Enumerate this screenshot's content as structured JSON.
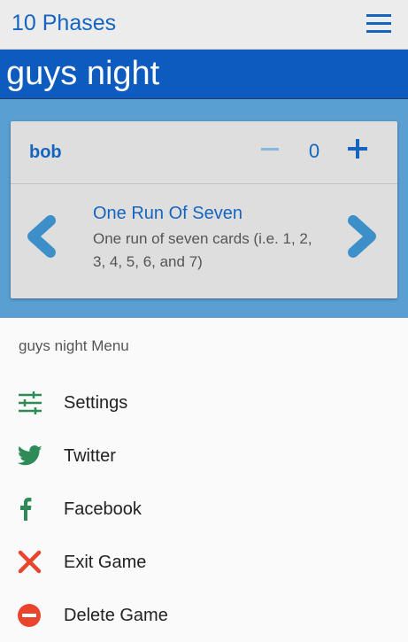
{
  "app": {
    "title": "10 Phases"
  },
  "game": {
    "title": "guys night"
  },
  "player": {
    "name": "bob",
    "score": "0",
    "phase_name": "One Run Of Seven",
    "phase_description": "One run of seven cards (i.e. 1, 2, 3, 4, 5, 6, and 7)"
  },
  "menu": {
    "title": "guys night Menu",
    "items": [
      {
        "label": "Settings",
        "icon": "settings-sliders-icon",
        "color": "#2e8b57"
      },
      {
        "label": "Twitter",
        "icon": "twitter-icon",
        "color": "#2e8b57"
      },
      {
        "label": "Facebook",
        "icon": "facebook-icon",
        "color": "#2e8b57"
      },
      {
        "label": "Exit Game",
        "icon": "close-x-icon",
        "color": "#e8452c"
      },
      {
        "label": "Delete Game",
        "icon": "minus-circle-icon",
        "color": "#e8452c"
      }
    ]
  },
  "colors": {
    "accent": "#1565c0",
    "banner": "#0d5bbe",
    "background": "#5a9fd1",
    "arrow": "#3d8fc9"
  }
}
